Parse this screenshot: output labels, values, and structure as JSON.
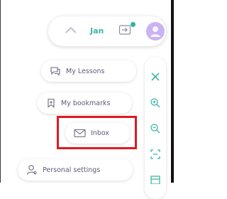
{
  "header": {
    "user_name": "Jan"
  },
  "menu": {
    "lessons_label": "My Lessons",
    "bookmarks_label": "My bookmarks",
    "inbox_label": "Inbox",
    "settings_label": "Personal settings"
  },
  "colors": {
    "accent": "#3fb5a7",
    "avatar": "#c9b3f2",
    "highlight": "#e0191f"
  },
  "icons": [
    "chevron-up-icon",
    "switch-account-icon",
    "notification-dot",
    "avatar-icon",
    "chat-bubble-icon",
    "bookmark-icon",
    "mail-icon",
    "person-icon",
    "close-icon",
    "zoom-in-icon",
    "zoom-out-icon",
    "fit-screen-icon",
    "panel-icon"
  ]
}
